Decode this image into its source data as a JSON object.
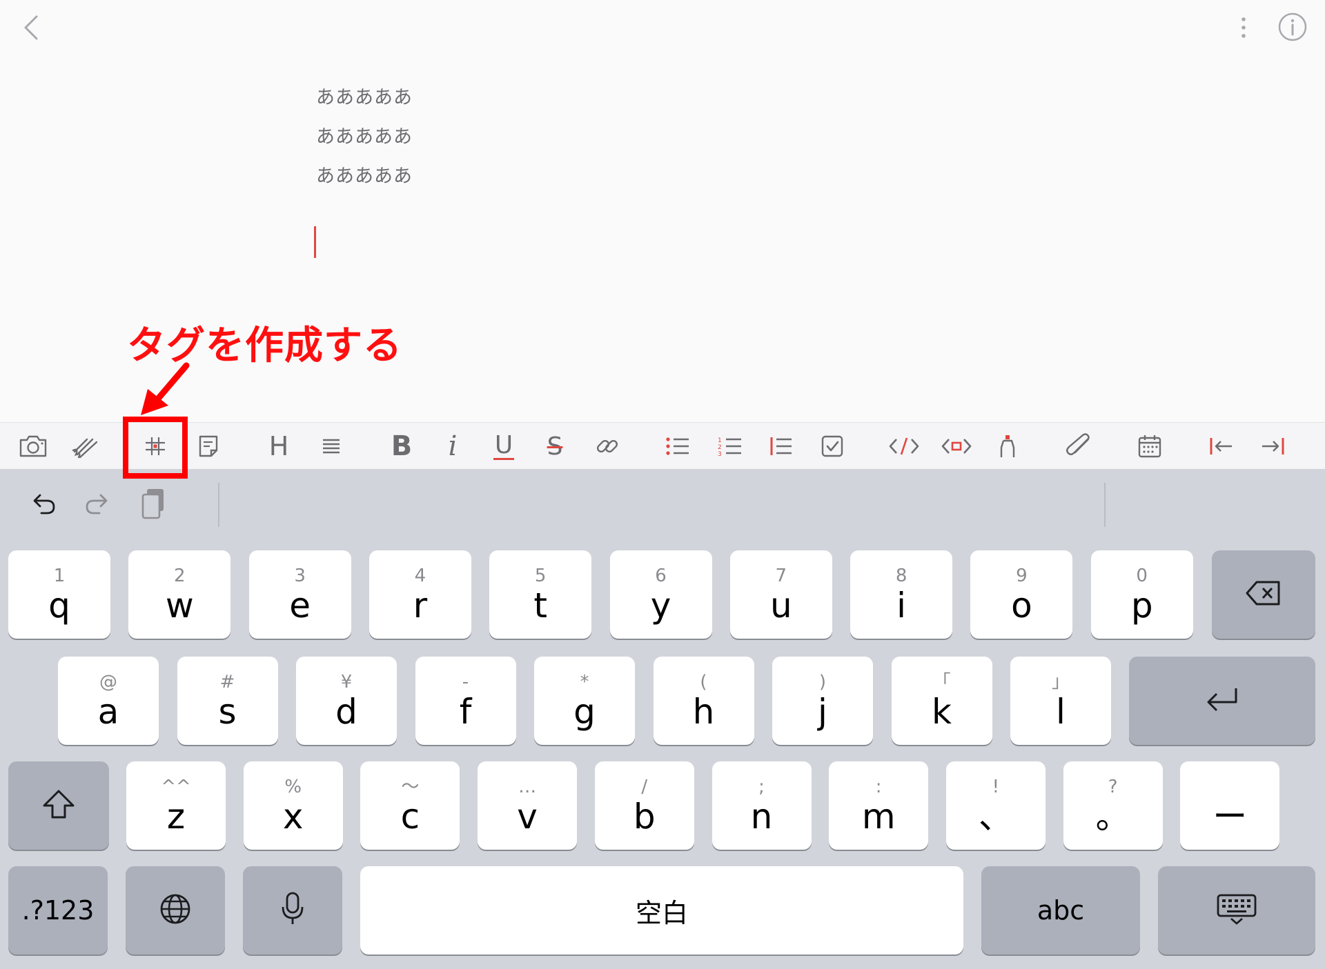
{
  "topbar": {
    "back": "chevron-left-icon",
    "more": "more-vertical-icon",
    "info": "info-icon"
  },
  "editor": {
    "lines": [
      "あああああ",
      "あああああ",
      "あああああ"
    ]
  },
  "annotation": {
    "text": "タグを作成する",
    "color": "#ff0000"
  },
  "toolbar": {
    "items": [
      "camera-icon",
      "handwriting-icon",
      "tag-icon",
      "note-icon",
      "heading-icon",
      "paragraph-icon",
      "bold-icon",
      "italic-icon",
      "underline-icon",
      "strikethrough-icon",
      "link-icon",
      "bullet-list-icon",
      "numbered-list-icon",
      "quote-icon",
      "checkbox-icon",
      "code-icon",
      "code-block-icon",
      "highlight-icon",
      "attachment-icon",
      "calendar-icon",
      "outdent-icon",
      "indent-icon"
    ],
    "labels": {
      "heading": "H",
      "bold": "B",
      "italic": "i",
      "underline": "U",
      "strike": "S"
    },
    "accent": "#e0473f"
  },
  "keyboard": {
    "row1": [
      {
        "main": "q",
        "sub": "1"
      },
      {
        "main": "w",
        "sub": "2"
      },
      {
        "main": "e",
        "sub": "3"
      },
      {
        "main": "r",
        "sub": "4"
      },
      {
        "main": "t",
        "sub": "5"
      },
      {
        "main": "y",
        "sub": "6"
      },
      {
        "main": "u",
        "sub": "7"
      },
      {
        "main": "i",
        "sub": "8"
      },
      {
        "main": "o",
        "sub": "9"
      },
      {
        "main": "p",
        "sub": "0"
      }
    ],
    "row2": [
      {
        "main": "a",
        "sub": "@"
      },
      {
        "main": "s",
        "sub": "#"
      },
      {
        "main": "d",
        "sub": "¥"
      },
      {
        "main": "f",
        "sub": "-"
      },
      {
        "main": "g",
        "sub": "*"
      },
      {
        "main": "h",
        "sub": "("
      },
      {
        "main": "j",
        "sub": ")"
      },
      {
        "main": "k",
        "sub": "「"
      },
      {
        "main": "l",
        "sub": "」"
      }
    ],
    "row3": [
      {
        "main": "z",
        "sub": "^^"
      },
      {
        "main": "x",
        "sub": "%"
      },
      {
        "main": "c",
        "sub": "〜"
      },
      {
        "main": "v",
        "sub": "…"
      },
      {
        "main": "b",
        "sub": "/"
      },
      {
        "main": "n",
        "sub": ";"
      },
      {
        "main": "m",
        "sub": ":"
      },
      {
        "main": "、",
        "sub": "!"
      },
      {
        "main": "。",
        "sub": "?"
      },
      {
        "main": "ー",
        "sub": ""
      }
    ],
    "numbers": ".?123",
    "space": "空白",
    "abc": "abc",
    "keys": {
      "delete": "delete-icon",
      "return": "return-icon",
      "shift": "shift-icon",
      "globe": "globe-icon",
      "mic": "microphone-icon",
      "hide": "keyboard-hide-icon"
    }
  },
  "colors": {
    "keyboard_bg": "#d1d4da",
    "key_dark": "#abb0bb",
    "icon_gray": "#6b6b70"
  }
}
